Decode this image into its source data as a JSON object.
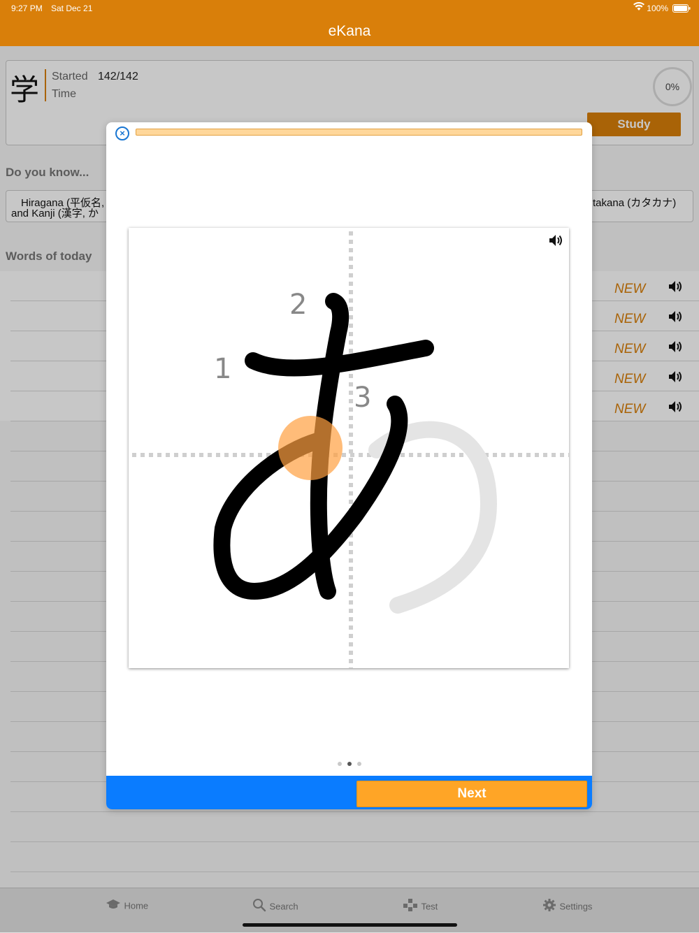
{
  "status_bar": {
    "time": "9:27 PM",
    "date": "Sat Dec 21",
    "battery": "100%"
  },
  "nav": {
    "title": "eKana"
  },
  "stats": {
    "kanji": "学",
    "started_label": "Started",
    "started_value": "142/142",
    "time_label": "Time",
    "progress_percent": "0%",
    "study_button": "Study"
  },
  "know": {
    "title": "Do you know...",
    "line1_left": "Hiragana (平仮名, ",
    "line2_left": "and Kanji (漢字, か",
    "line1_right": "takana (カタカナ)"
  },
  "words": {
    "title": "Words of today",
    "rows": [
      {
        "badge": "NEW"
      },
      {
        "badge": "NEW"
      },
      {
        "badge": "NEW"
      },
      {
        "badge": "NEW"
      },
      {
        "badge": "NEW"
      }
    ]
  },
  "tabs": [
    {
      "label": "Home",
      "icon": "graduation-cap-icon"
    },
    {
      "label": "Search",
      "icon": "search-icon"
    },
    {
      "label": "Test",
      "icon": "gamepad-icon"
    },
    {
      "label": "Settings",
      "icon": "gear-icon"
    }
  ],
  "modal": {
    "stroke_numbers": [
      "1",
      "2",
      "3"
    ],
    "pages": 3,
    "active_page": 2,
    "next_button": "Next"
  },
  "colors": {
    "brand_orange": "#d97f0a",
    "next_orange": "#ffa526",
    "footer_blue": "#0a7cff",
    "touch_marker": "#ffa040"
  }
}
